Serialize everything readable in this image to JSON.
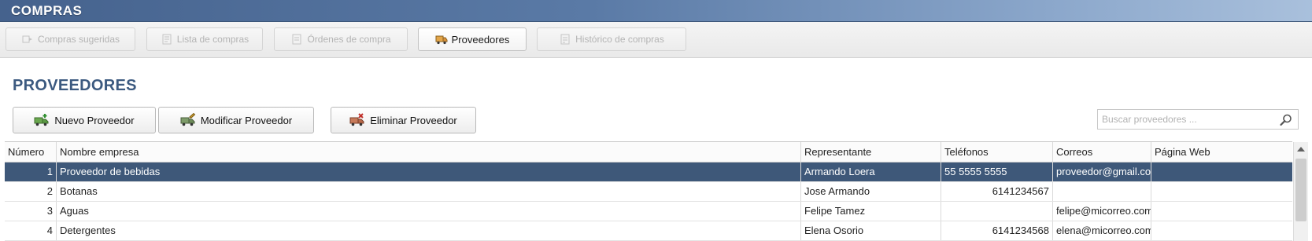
{
  "window": {
    "title": "COMPRAS"
  },
  "tabs": [
    {
      "label": "Compras sugeridas",
      "icon": "suggested-icon",
      "active": false
    },
    {
      "label": "Lista de compras",
      "icon": "list-icon",
      "active": false
    },
    {
      "label": "Órdenes de compra",
      "icon": "order-icon",
      "active": false
    },
    {
      "label": "Proveedores",
      "icon": "truck-icon",
      "active": true
    },
    {
      "label": "Histórico de compras",
      "icon": "history-icon",
      "active": false
    }
  ],
  "page": {
    "title": "PROVEEDORES"
  },
  "toolbar": {
    "new_label": "Nuevo Proveedor",
    "edit_label": "Modificar Proveedor",
    "delete_label": "Eliminar Proveedor"
  },
  "search": {
    "placeholder": "Buscar proveedores ..."
  },
  "table": {
    "columns": [
      "Número",
      "Nombre empresa",
      "Representante",
      "Teléfonos",
      "Correos",
      "Página Web"
    ],
    "rows": [
      {
        "num": "1",
        "name": "Proveedor de bebidas",
        "rep": "Armando Loera",
        "phone": "55 5555 5555",
        "email": "proveedor@gmail.com",
        "web": ""
      },
      {
        "num": "2",
        "name": "Botanas",
        "rep": "Jose Armando",
        "phone": "6141234567",
        "email": "",
        "web": ""
      },
      {
        "num": "3",
        "name": "Aguas",
        "rep": "Felipe Tamez",
        "phone": "",
        "email": "felipe@micorreo.com",
        "web": ""
      },
      {
        "num": "4",
        "name": "Detergentes",
        "rep": "Elena Osorio",
        "phone": "6141234568",
        "email": "elena@micorreo.com",
        "web": ""
      }
    ]
  },
  "colors": {
    "titlebar": "#4f6e99",
    "heading": "#3c5a80",
    "selected_row": "#3e5879"
  }
}
